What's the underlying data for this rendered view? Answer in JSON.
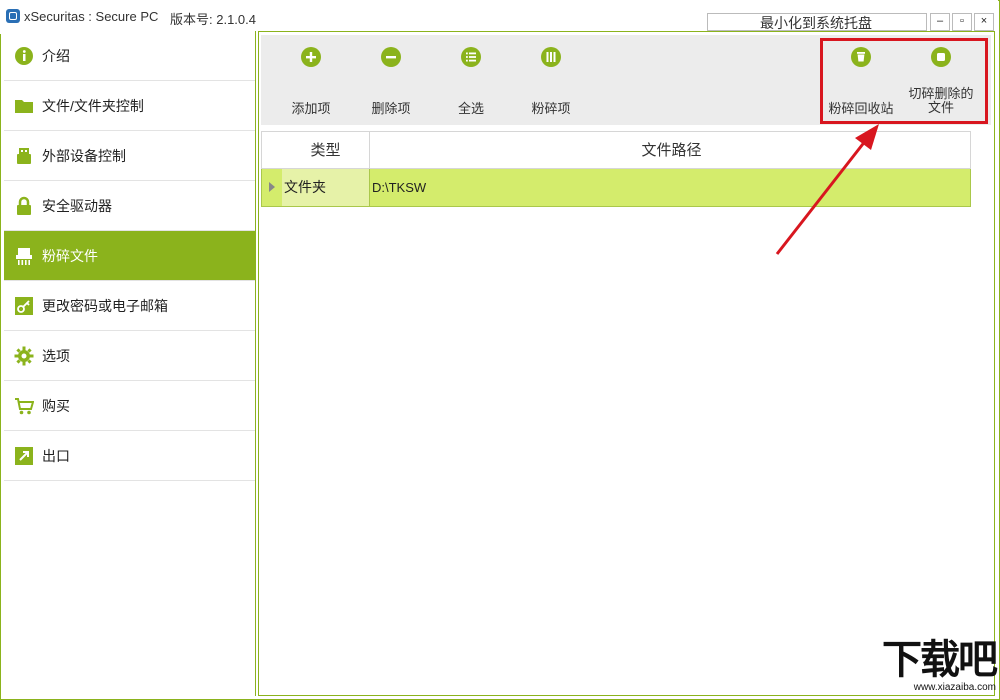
{
  "window": {
    "title": "xSecuritas : Secure PC",
    "version": "版本号: 2.1.0.4",
    "tray_button": "最小化到系统托盘",
    "minimize": "–",
    "maximize": "▫",
    "close": "×"
  },
  "sidebar": {
    "items": [
      {
        "label": "介绍",
        "icon": "info-icon"
      },
      {
        "label": "文件/文件夹控制",
        "icon": "folder-icon"
      },
      {
        "label": "外部设备控制",
        "icon": "usb-icon"
      },
      {
        "label": "安全驱动器",
        "icon": "lock-icon"
      },
      {
        "label": "粉碎文件",
        "icon": "shredder-icon",
        "active": true
      },
      {
        "label": "更改密码或电子邮箱",
        "icon": "key-icon"
      },
      {
        "label": "选项",
        "icon": "gear-icon"
      },
      {
        "label": "购买",
        "icon": "cart-icon"
      },
      {
        "label": "出口",
        "icon": "exit-icon"
      }
    ]
  },
  "toolbar": {
    "add": "添加项",
    "delete": "删除项",
    "select_all": "全选",
    "shred": "粉碎项",
    "shred_recycle_bin": "粉碎回收站",
    "shred_deleted_line1": "切碎删除的",
    "shred_deleted_line2": "文件"
  },
  "table": {
    "headers": {
      "type": "类型",
      "path": "文件路径"
    },
    "rows": [
      {
        "type": "文件夹",
        "path": "D:\\TKSW"
      }
    ]
  },
  "watermark": {
    "main": "下载吧",
    "sub": "www.xiazaiba.com"
  },
  "colors": {
    "accent": "#8bb31c",
    "row_highlight": "#d4ec6c",
    "annotation": "#d8161f"
  }
}
